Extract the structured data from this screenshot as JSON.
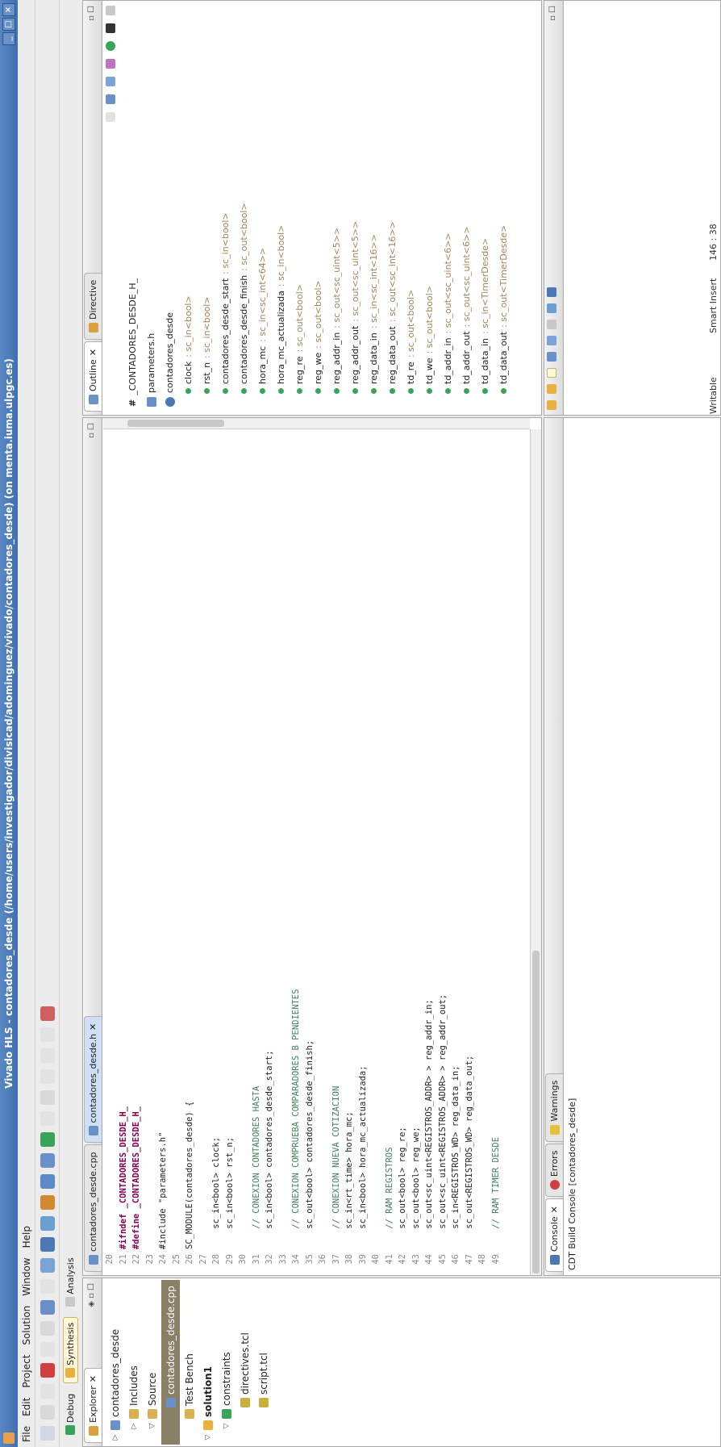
{
  "window": {
    "title": "Vivado HLS - contadores_desde (/home/users/investigador/divisicad/adominguez/vivado/contadores_desde)   (on menta.iuma.ulpgc.es)"
  },
  "menu": [
    "File",
    "Edit",
    "Project",
    "Solution",
    "Window",
    "Help"
  ],
  "perspectives": {
    "debug": "Debug",
    "synthesis": "Synthesis",
    "analysis": "Analysis"
  },
  "explorer": {
    "tab_label": "Explorer",
    "items": [
      {
        "label": "contadores_desde",
        "indent": 0,
        "arrow": "▷",
        "icon": "project"
      },
      {
        "label": "Includes",
        "indent": 1,
        "arrow": "▷",
        "icon": "folder"
      },
      {
        "label": "Source",
        "indent": 1,
        "arrow": "▽",
        "icon": "folder"
      },
      {
        "label": "contadores_desde.cpp",
        "indent": 2,
        "arrow": "",
        "icon": "file",
        "selected": true
      },
      {
        "label": "Test Bench",
        "indent": 1,
        "arrow": "",
        "icon": "folder"
      },
      {
        "label": "solution1",
        "indent": 0,
        "arrow": "▽",
        "icon": "solution",
        "bold": true
      },
      {
        "label": "constraints",
        "indent": 1,
        "arrow": "▽",
        "icon": "constraint"
      },
      {
        "label": "directives.tcl",
        "indent": 2,
        "arrow": "",
        "icon": "tcl"
      },
      {
        "label": "script.tcl",
        "indent": 2,
        "arrow": "",
        "icon": "tcl"
      }
    ]
  },
  "editor": {
    "tabs": [
      "contadores_desde.cpp",
      "contadores_desde.h"
    ],
    "lines": [
      {
        "n": "20",
        "t": ""
      },
      {
        "n": "21",
        "t": "#ifndef _CONTADORES_DESDE_H_",
        "k": "pp"
      },
      {
        "n": "22",
        "t": "#define _CONTADORES_DESDE_H_",
        "k": "pp"
      },
      {
        "n": "23",
        "t": ""
      },
      {
        "n": "24",
        "t": "#include \"parameters.h\"",
        "k": "inc"
      },
      {
        "n": "25",
        "t": ""
      },
      {
        "n": "26",
        "t": "SC_MODULE(contadores_desde) {"
      },
      {
        "n": "27",
        "t": ""
      },
      {
        "n": "28",
        "t": "    sc_in<bool> clock;",
        "k": "port"
      },
      {
        "n": "29",
        "t": "    sc_in<bool> rst_n;",
        "k": "port"
      },
      {
        "n": "30",
        "t": ""
      },
      {
        "n": "31",
        "t": "    // CONEXION CONTADORES HASTA",
        "k": "cm"
      },
      {
        "n": "32",
        "t": "    sc_in<bool> contadores_desde_start;",
        "k": "port"
      },
      {
        "n": "33",
        "t": ""
      },
      {
        "n": "34",
        "t": "    // CONEXION COMPRUEBA COMPARADORES B PENDIENTES",
        "k": "cm"
      },
      {
        "n": "35",
        "t": "    sc_out<bool> contadores_desde_finish;",
        "k": "port"
      },
      {
        "n": "36",
        "t": ""
      },
      {
        "n": "37",
        "t": "    // CONEXION NUEVA COTIZACION",
        "k": "cm"
      },
      {
        "n": "38",
        "t": "    sc_in<rt_time> hora_mc;"
      },
      {
        "n": "39",
        "t": "    sc_in<bool> hora_mc_actualizada;",
        "k": "port"
      },
      {
        "n": "40",
        "t": ""
      },
      {
        "n": "41",
        "t": "    // RAM REGISTROS",
        "k": "cm"
      },
      {
        "n": "42",
        "t": "    sc_out<bool> reg_re;",
        "k": "port"
      },
      {
        "n": "43",
        "t": "    sc_out<bool> reg_we;",
        "k": "port"
      },
      {
        "n": "44",
        "t": "    sc_out<sc_uint<REGISTROS_ADDR> > reg_addr_in;"
      },
      {
        "n": "45",
        "t": "    sc_out<sc_uint<REGISTROS_ADDR> > reg_addr_out;"
      },
      {
        "n": "46",
        "t": "    sc_in<REGISTROS_WD> reg_data_in;"
      },
      {
        "n": "47",
        "t": "    sc_out<REGISTROS_WD> reg_data_out;"
      },
      {
        "n": "48",
        "t": ""
      },
      {
        "n": "49",
        "t": "    // RAM TIMER DESDE",
        "k": "cm"
      }
    ]
  },
  "outline": {
    "tabs": [
      "Outline",
      "Directive"
    ],
    "items": [
      {
        "name": "_CONTADORES_DESDE_H_",
        "type": "",
        "icon": "#",
        "indent": 0
      },
      {
        "name": "parameters.h",
        "type": "",
        "icon": "inc",
        "indent": 0
      },
      {
        "name": "contadores_desde",
        "type": "",
        "icon": "class",
        "indent": 0
      },
      {
        "name": "clock",
        "type": " : sc_in<bool>",
        "icon": "dot",
        "indent": 1
      },
      {
        "name": "rst_n",
        "type": " : sc_in<bool>",
        "icon": "dot",
        "indent": 1
      },
      {
        "name": "contadores_desde_start",
        "type": " : sc_in<bool>",
        "icon": "dot",
        "indent": 1
      },
      {
        "name": "contadores_desde_finish",
        "type": " : sc_out<bool>",
        "icon": "dot",
        "indent": 1
      },
      {
        "name": "hora_mc",
        "type": " : sc_in<sc_int<64>>",
        "icon": "dot",
        "indent": 1
      },
      {
        "name": "hora_mc_actualizada",
        "type": " : sc_in<bool>",
        "icon": "dot",
        "indent": 1
      },
      {
        "name": "reg_re",
        "type": " : sc_out<bool>",
        "icon": "dot",
        "indent": 1
      },
      {
        "name": "reg_we",
        "type": " : sc_out<bool>",
        "icon": "dot",
        "indent": 1
      },
      {
        "name": "reg_addr_in",
        "type": " : sc_out<sc_uint<5>>",
        "icon": "dot",
        "indent": 1
      },
      {
        "name": "reg_addr_out",
        "type": " : sc_out<sc_uint<5>>",
        "icon": "dot",
        "indent": 1
      },
      {
        "name": "reg_data_in",
        "type": " : sc_in<sc_int<16>>",
        "icon": "dot",
        "indent": 1
      },
      {
        "name": "reg_data_out",
        "type": " : sc_out<sc_int<16>>",
        "icon": "dot",
        "indent": 1
      },
      {
        "name": "td_re",
        "type": " : sc_out<bool>",
        "icon": "dot",
        "indent": 1
      },
      {
        "name": "td_we",
        "type": " : sc_out<bool>",
        "icon": "dot",
        "indent": 1
      },
      {
        "name": "td_addr_in",
        "type": " : sc_out<sc_uint<6>>",
        "icon": "dot",
        "indent": 1
      },
      {
        "name": "td_addr_out",
        "type": " : sc_out<sc_uint<6>>",
        "icon": "dot",
        "indent": 1
      },
      {
        "name": "td_data_in",
        "type": " : sc_in<TimerDesde>",
        "icon": "dot",
        "indent": 1
      },
      {
        "name": "td_data_out",
        "type": " : sc_out<TimerDesde>",
        "icon": "dot",
        "indent": 1
      }
    ]
  },
  "console": {
    "tabs": [
      "Console",
      "Errors",
      "Warnings"
    ],
    "text": "CDT Build Console [contadores_desde]"
  },
  "status": {
    "writable": "Writable",
    "insert_mode": "Smart Insert",
    "position": "146 : 38"
  },
  "colors": {
    "title_bar": "#4a7bb9",
    "keyword": "#7f0055",
    "comment": "#3f7f5f",
    "string": "#2a00ff",
    "selected_row": "#8a8068"
  }
}
